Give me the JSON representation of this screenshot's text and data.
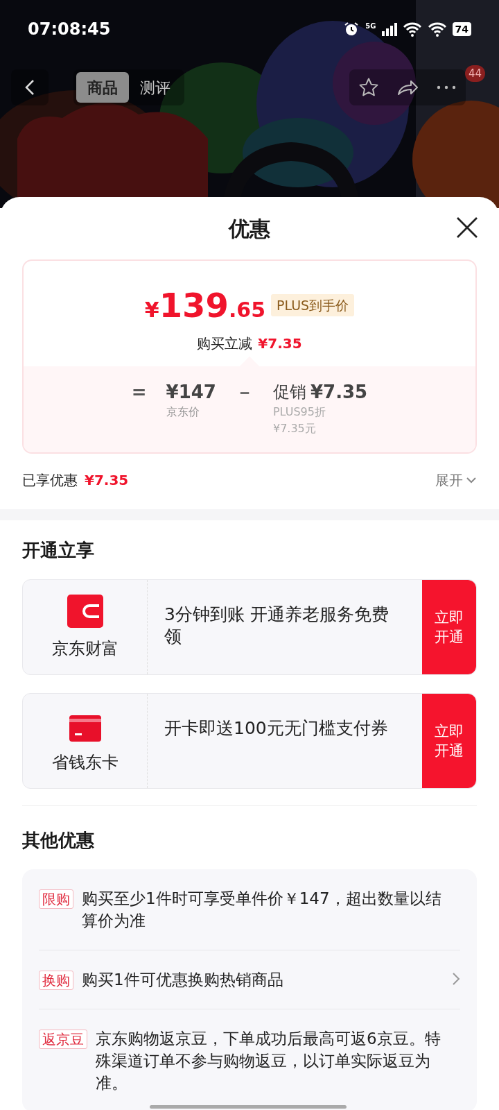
{
  "status_bar": {
    "time": "07:08:45",
    "network": "5G",
    "battery": "74"
  },
  "nav": {
    "tabs": [
      {
        "label": "商品",
        "selected": true
      },
      {
        "label": "测评",
        "selected": false
      }
    ],
    "badge": "44"
  },
  "sheet": {
    "title": "优惠",
    "price": {
      "currency": "¥",
      "integer": "139",
      "decimal": ".65",
      "tag": "PLUS到手价",
      "reduction_label": "购买立减",
      "reduction": "¥7.35"
    },
    "breakdown": {
      "equals": "=",
      "base_price": "¥147",
      "base_label": "京东价",
      "minus": "－",
      "promo_label": "促销",
      "promo_amount": "¥7.35",
      "promo_notes": [
        "PLUS95折",
        "¥7.35元"
      ]
    },
    "enjoyed": {
      "label": "已享优惠",
      "amount": "¥7.35",
      "expand": "展开"
    },
    "open_section": {
      "title": "开通立享",
      "offers": [
        {
          "kind": "wallet",
          "name": "京东财富",
          "text": "3分钟到账 开通养老服务免费领",
          "button": "立即开通"
        },
        {
          "kind": "card",
          "name": "省钱东卡",
          "text": "开卡即送100元无门槛支付券",
          "button": "立即开通"
        }
      ]
    },
    "other_section": {
      "title": "其他优惠",
      "items": [
        {
          "tag": "限购",
          "text": "购买至少1件时可享受单件价￥147，超出数量以结算价为准",
          "arrow": false
        },
        {
          "tag": "换购",
          "text": "购买1件可优惠换购热销商品",
          "arrow": true
        },
        {
          "tag": "返京豆",
          "text": "京东购物返京豆，下单成功后最高可返6京豆。特殊渠道订单不参与购物返豆，以订单实际返豆为准。",
          "arrow": false
        }
      ]
    }
  }
}
